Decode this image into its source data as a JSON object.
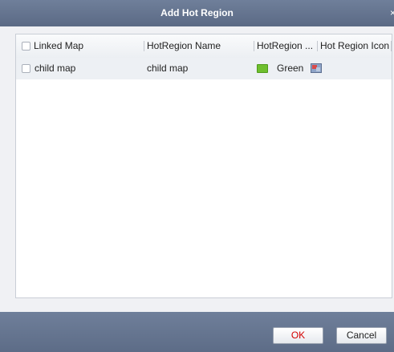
{
  "dialog": {
    "title": "Add Hot Region",
    "close_glyph": "×"
  },
  "table": {
    "columns": [
      "Linked Map",
      "HotRegion Name",
      "HotRegion ...",
      "Hot Region Icon"
    ],
    "rows": [
      {
        "linked_map": "child map",
        "name": "child map",
        "color": "Green",
        "color_hex": "#6fbf2e",
        "icon": "hot-region-map-icon"
      }
    ]
  },
  "buttons": {
    "ok": "OK",
    "cancel": "Cancel"
  },
  "colors": {
    "titlebar": "#5b6a85",
    "ok_text": "#d40000"
  }
}
